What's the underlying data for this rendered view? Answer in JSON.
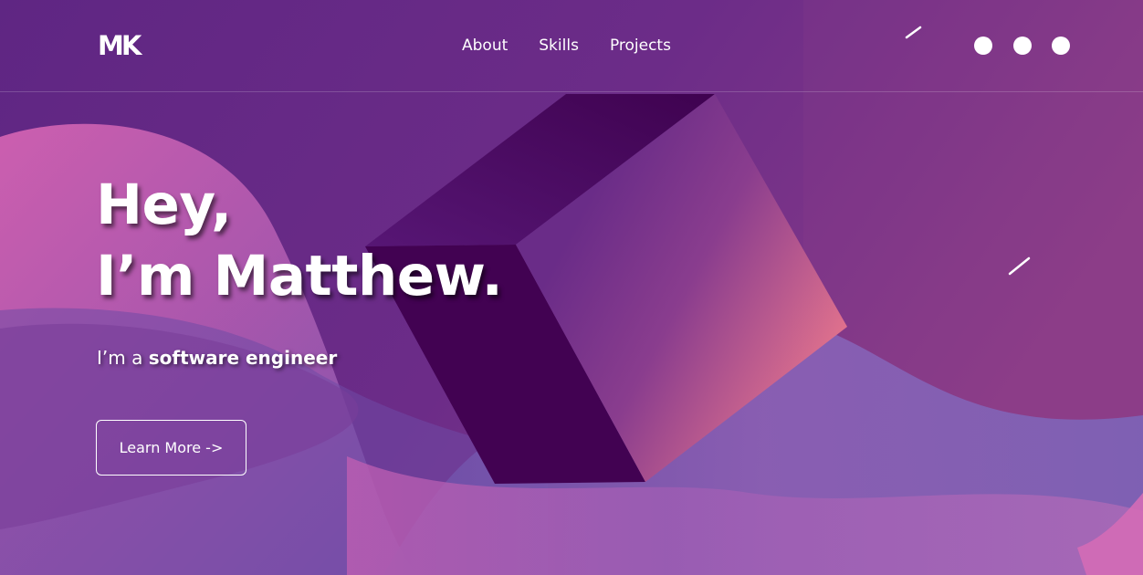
{
  "header": {
    "logo": "MK",
    "nav": [
      "About",
      "Skills",
      "Projects"
    ],
    "social_icons": [
      "social-icon-1",
      "social-icon-2",
      "social-icon-3"
    ]
  },
  "hero": {
    "title_line1": "Hey,",
    "title_line2": "I’m Matthew.",
    "subtitle_prefix": "I’m a ",
    "subtitle_role": "software engineer",
    "cta_label": "Learn More ->"
  },
  "colors": {
    "background_base": "#6a2b86",
    "cube_dark": "#420252",
    "cube_pink": "#f07a8e",
    "wave_pink": "#d664b4",
    "wave_blue": "#7e5fb4",
    "text": "#ffffff"
  }
}
